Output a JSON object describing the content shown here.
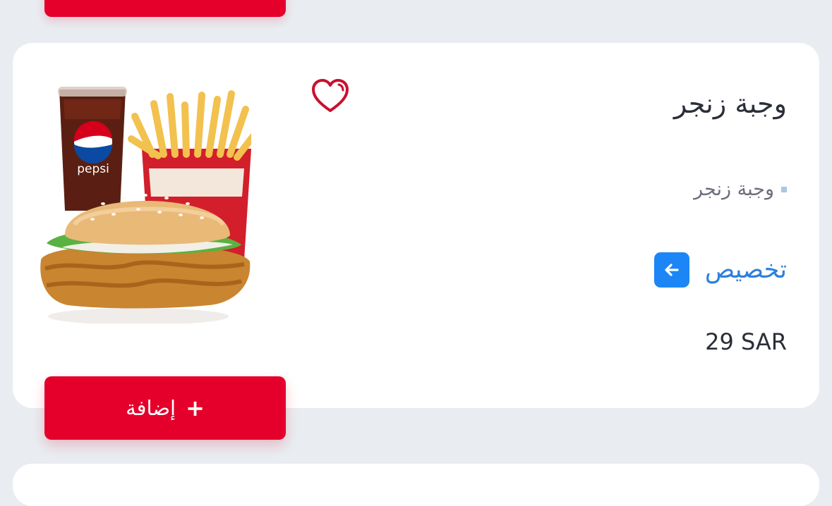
{
  "product": {
    "title": "وجبة زنجر",
    "description": "وجبة زنجر",
    "customize_label": "تخصيص",
    "price": "29 SAR",
    "add_label": "إضافة",
    "add_icon": "+"
  },
  "icons": {
    "favorite": "heart-outline-icon",
    "customize": "arrow-left-icon",
    "add": "plus-icon"
  },
  "colors": {
    "brand_red": "#e4002b",
    "customize_blue": "#2f7fdc",
    "arrow_button_blue": "#1c86f7",
    "heart_red": "#c8102e",
    "background": "#e9edf1"
  }
}
